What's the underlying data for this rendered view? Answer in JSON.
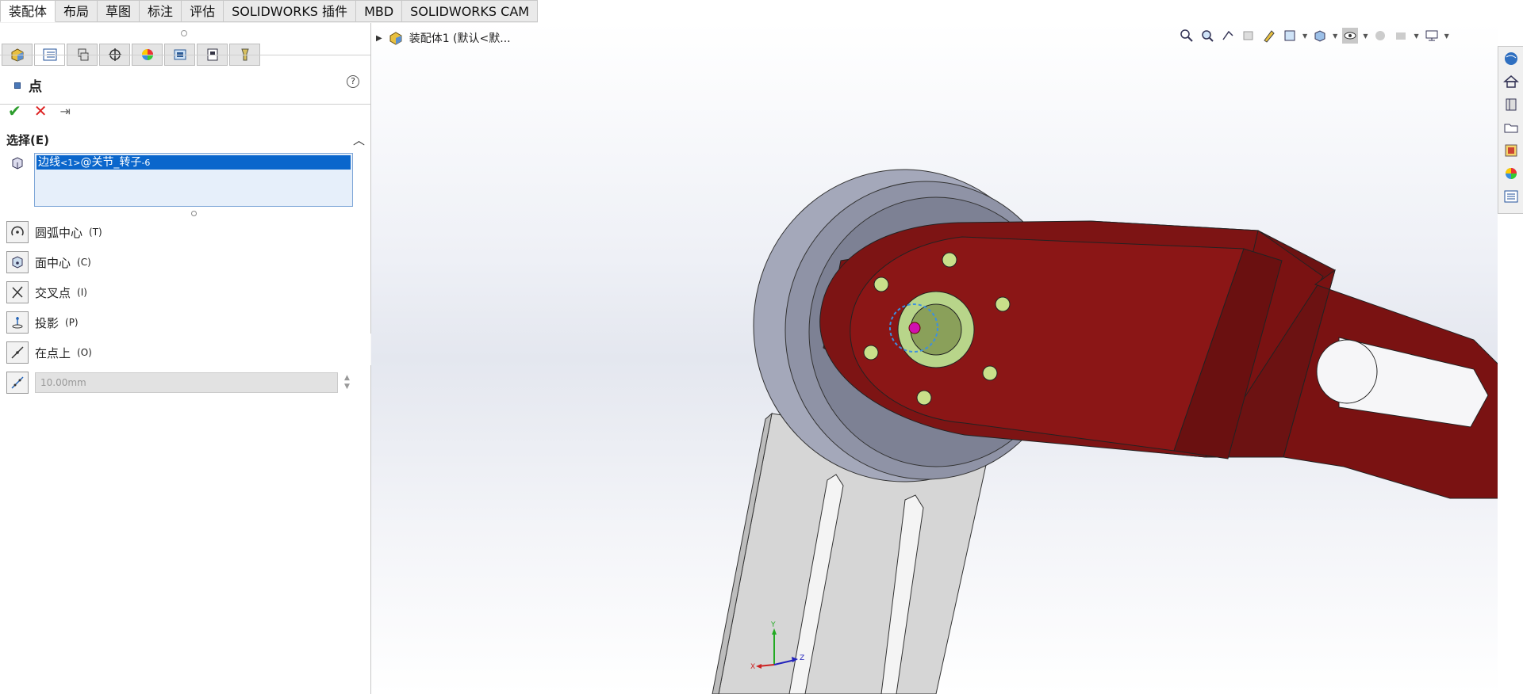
{
  "tabs": [
    {
      "label": "装配体",
      "active": true
    },
    {
      "label": "布局"
    },
    {
      "label": "草图"
    },
    {
      "label": "标注"
    },
    {
      "label": "评估"
    },
    {
      "label": "SOLIDWORKS 插件"
    },
    {
      "label": "MBD"
    },
    {
      "label": "SOLIDWORKS CAM"
    }
  ],
  "property_manager": {
    "title": "点",
    "help_icon": "?",
    "selection_group": "选择(E)",
    "selected_item_main": "边线",
    "selected_item_small1": "<1>",
    "selected_item_main2": "@关节_转子",
    "selected_item_small2": "-6",
    "options": [
      {
        "icon": "arc-center-icon",
        "label": "圆弧中心",
        "shortcut": "(T)"
      },
      {
        "icon": "face-center-icon",
        "label": "面中心",
        "shortcut": "(C)"
      },
      {
        "icon": "intersection-icon",
        "label": "交叉点",
        "shortcut": "(I)"
      },
      {
        "icon": "projection-icon",
        "label": "投影",
        "shortcut": "(P)"
      },
      {
        "icon": "on-point-icon",
        "label": "在点上",
        "shortcut": "(O)"
      }
    ],
    "distance_value": "10.00mm"
  },
  "viewport": {
    "tree_root": "装配体1  (默认<默..."
  },
  "triad": {
    "x": "X",
    "y": "Y",
    "z": "Z"
  },
  "colors": {
    "selection_blue": "#0a66cc",
    "part_red": "#7a1212",
    "disk_grey": "#8f93a6",
    "ok_green": "#2d9d2d",
    "cancel_red": "#d22222"
  }
}
